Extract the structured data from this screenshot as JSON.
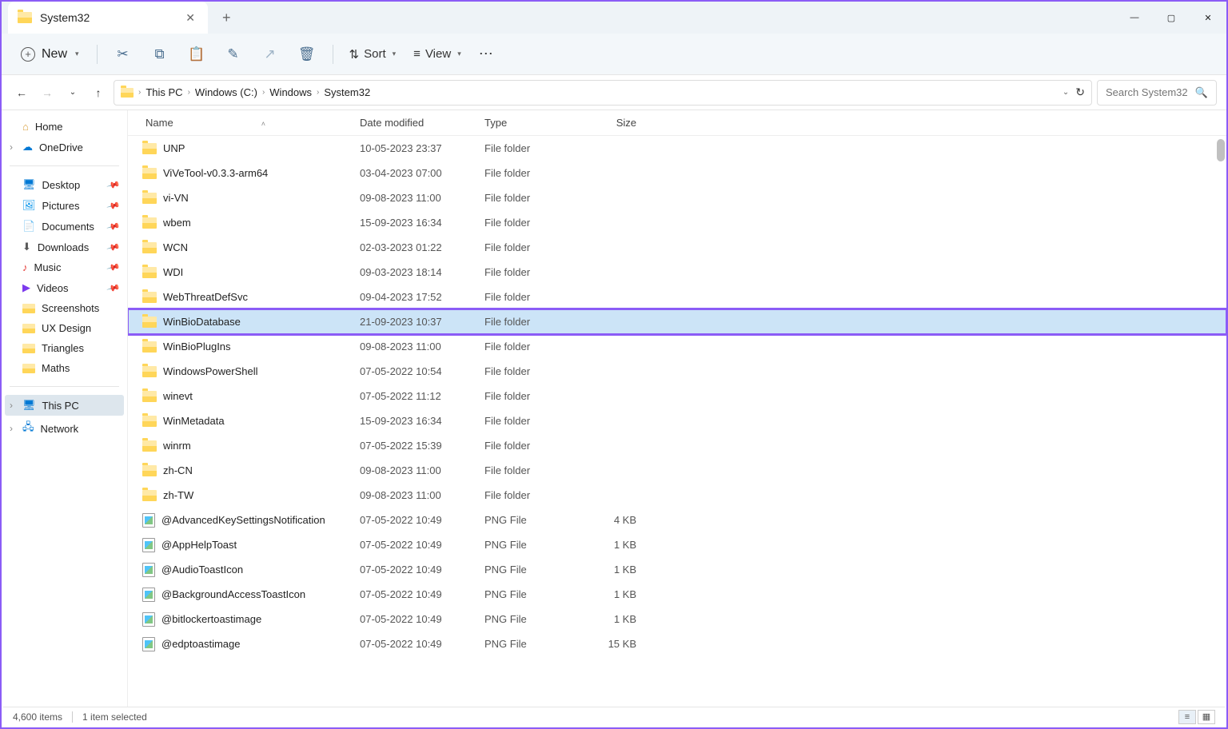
{
  "tab": {
    "title": "System32"
  },
  "toolbar": {
    "new": "New",
    "sort": "Sort",
    "view": "View"
  },
  "breadcrumbs": [
    "This PC",
    "Windows (C:)",
    "Windows",
    "System32"
  ],
  "search": {
    "placeholder": "Search System32"
  },
  "columns": {
    "name": "Name",
    "date": "Date modified",
    "type": "Type",
    "size": "Size"
  },
  "nav": {
    "home": "Home",
    "onedrive": "OneDrive",
    "desktop": "Desktop",
    "pictures": "Pictures",
    "documents": "Documents",
    "downloads": "Downloads",
    "music": "Music",
    "videos": "Videos",
    "screenshots": "Screenshots",
    "uxdesign": "UX Design",
    "triangles": "Triangles",
    "maths": "Maths",
    "thispc": "This PC",
    "network": "Network"
  },
  "rows": [
    {
      "name": "UNP",
      "date": "10-05-2023 23:37",
      "type": "File folder",
      "size": "",
      "icon": "folder"
    },
    {
      "name": "ViVeTool-v0.3.3-arm64",
      "date": "03-04-2023 07:00",
      "type": "File folder",
      "size": "",
      "icon": "folder"
    },
    {
      "name": "vi-VN",
      "date": "09-08-2023 11:00",
      "type": "File folder",
      "size": "",
      "icon": "folder"
    },
    {
      "name": "wbem",
      "date": "15-09-2023 16:34",
      "type": "File folder",
      "size": "",
      "icon": "folder"
    },
    {
      "name": "WCN",
      "date": "02-03-2023 01:22",
      "type": "File folder",
      "size": "",
      "icon": "folder"
    },
    {
      "name": "WDI",
      "date": "09-03-2023 18:14",
      "type": "File folder",
      "size": "",
      "icon": "folder"
    },
    {
      "name": "WebThreatDefSvc",
      "date": "09-04-2023 17:52",
      "type": "File folder",
      "size": "",
      "icon": "folder"
    },
    {
      "name": "WinBioDatabase",
      "date": "21-09-2023 10:37",
      "type": "File folder",
      "size": "",
      "icon": "folder",
      "highlight": true
    },
    {
      "name": "WinBioPlugIns",
      "date": "09-08-2023 11:00",
      "type": "File folder",
      "size": "",
      "icon": "folder"
    },
    {
      "name": "WindowsPowerShell",
      "date": "07-05-2022 10:54",
      "type": "File folder",
      "size": "",
      "icon": "folder"
    },
    {
      "name": "winevt",
      "date": "07-05-2022 11:12",
      "type": "File folder",
      "size": "",
      "icon": "folder"
    },
    {
      "name": "WinMetadata",
      "date": "15-09-2023 16:34",
      "type": "File folder",
      "size": "",
      "icon": "folder"
    },
    {
      "name": "winrm",
      "date": "07-05-2022 15:39",
      "type": "File folder",
      "size": "",
      "icon": "folder"
    },
    {
      "name": "zh-CN",
      "date": "09-08-2023 11:00",
      "type": "File folder",
      "size": "",
      "icon": "folder"
    },
    {
      "name": "zh-TW",
      "date": "09-08-2023 11:00",
      "type": "File folder",
      "size": "",
      "icon": "folder"
    },
    {
      "name": "@AdvancedKeySettingsNotification",
      "date": "07-05-2022 10:49",
      "type": "PNG File",
      "size": "4 KB",
      "icon": "png"
    },
    {
      "name": "@AppHelpToast",
      "date": "07-05-2022 10:49",
      "type": "PNG File",
      "size": "1 KB",
      "icon": "png"
    },
    {
      "name": "@AudioToastIcon",
      "date": "07-05-2022 10:49",
      "type": "PNG File",
      "size": "1 KB",
      "icon": "png"
    },
    {
      "name": "@BackgroundAccessToastIcon",
      "date": "07-05-2022 10:49",
      "type": "PNG File",
      "size": "1 KB",
      "icon": "png"
    },
    {
      "name": "@bitlockertoastimage",
      "date": "07-05-2022 10:49",
      "type": "PNG File",
      "size": "1 KB",
      "icon": "png"
    },
    {
      "name": "@edptoastimage",
      "date": "07-05-2022 10:49",
      "type": "PNG File",
      "size": "15 KB",
      "icon": "png"
    }
  ],
  "status": {
    "count": "4,600 items",
    "selected": "1 item selected"
  }
}
